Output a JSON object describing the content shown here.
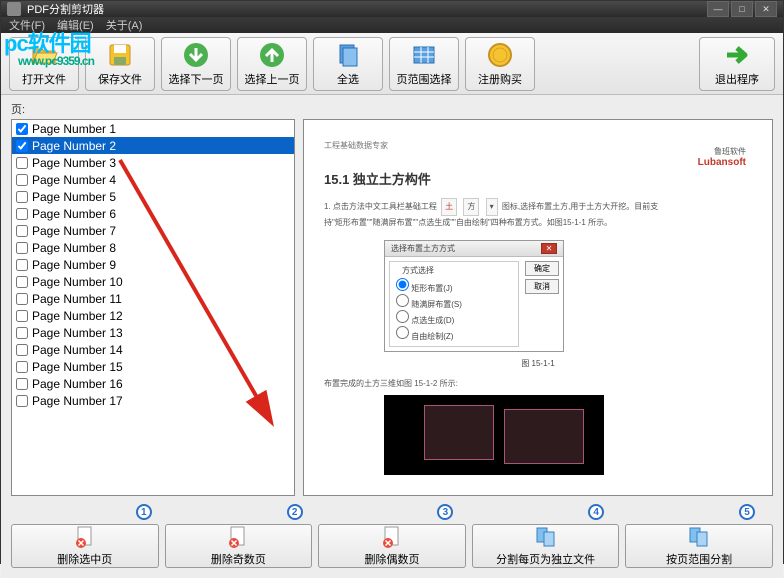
{
  "window": {
    "title": "PDF分割剪切器"
  },
  "menu": {
    "file": "文件(F)",
    "edit": "编辑(E)",
    "about": "关于(A)"
  },
  "watermark": {
    "text": "pc软件园",
    "url": "www.pc9359.cn"
  },
  "toolbar": {
    "open": "打开文件",
    "save": "保存文件",
    "select_next": "选择下一页",
    "select_prev": "选择上一页",
    "select_all": "全选",
    "page_range": "页范围选择",
    "register": "注册购买",
    "exit": "退出程序"
  },
  "content": {
    "pages_label": "页:"
  },
  "pages": [
    {
      "label": "Page Number 1",
      "checked": true,
      "selected": false
    },
    {
      "label": "Page Number 2",
      "checked": true,
      "selected": true
    },
    {
      "label": "Page Number 3",
      "checked": false,
      "selected": false
    },
    {
      "label": "Page Number 4",
      "checked": false,
      "selected": false
    },
    {
      "label": "Page Number 5",
      "checked": false,
      "selected": false
    },
    {
      "label": "Page Number 6",
      "checked": false,
      "selected": false
    },
    {
      "label": "Page Number 7",
      "checked": false,
      "selected": false
    },
    {
      "label": "Page Number 8",
      "checked": false,
      "selected": false
    },
    {
      "label": "Page Number 9",
      "checked": false,
      "selected": false
    },
    {
      "label": "Page Number 10",
      "checked": false,
      "selected": false
    },
    {
      "label": "Page Number 11",
      "checked": false,
      "selected": false
    },
    {
      "label": "Page Number 12",
      "checked": false,
      "selected": false
    },
    {
      "label": "Page Number 13",
      "checked": false,
      "selected": false
    },
    {
      "label": "Page Number 14",
      "checked": false,
      "selected": false
    },
    {
      "label": "Page Number 15",
      "checked": false,
      "selected": false
    },
    {
      "label": "Page Number 16",
      "checked": false,
      "selected": false
    },
    {
      "label": "Page Number 17",
      "checked": false,
      "selected": false
    }
  ],
  "preview": {
    "header_small": "工程基础数据专家",
    "header_company1": "鲁班软件",
    "header_company2": "Lubansoft",
    "h3": "15.1 独立土方构件",
    "p1a": "1. 点击方法中文工具栏基础工程",
    "btn_tu": "土",
    "btn_fang": "方",
    "p1b": "图标,选择布置土方,用于土方大开挖。目前支",
    "p2": "持\"矩形布置\"\"随满屏布置\"\"点选生成\"\"自由绘制\"四种布置方式。如图15-1-1 所示。",
    "dialog_title": "选择布置土方方式",
    "dialog_group": "方式选择",
    "opt1": "矩形布置(J)",
    "opt2": "随满屏布置(S)",
    "opt3": "点选生成(D)",
    "opt4": "自由绘制(Z)",
    "btn_ok": "确定",
    "btn_cancel": "取消",
    "fig1_caption": "图 15-1-1",
    "p3": "布置完成的土方三维如图 15-1-2 所示:"
  },
  "badges": [
    "1",
    "2",
    "3",
    "4",
    "5"
  ],
  "bottom": {
    "delete_selected": "删除选中页",
    "delete_odd": "删除奇数页",
    "delete_even": "删除偶数页",
    "split_each": "分割每页为独立文件",
    "split_range": "按页范围分割"
  }
}
